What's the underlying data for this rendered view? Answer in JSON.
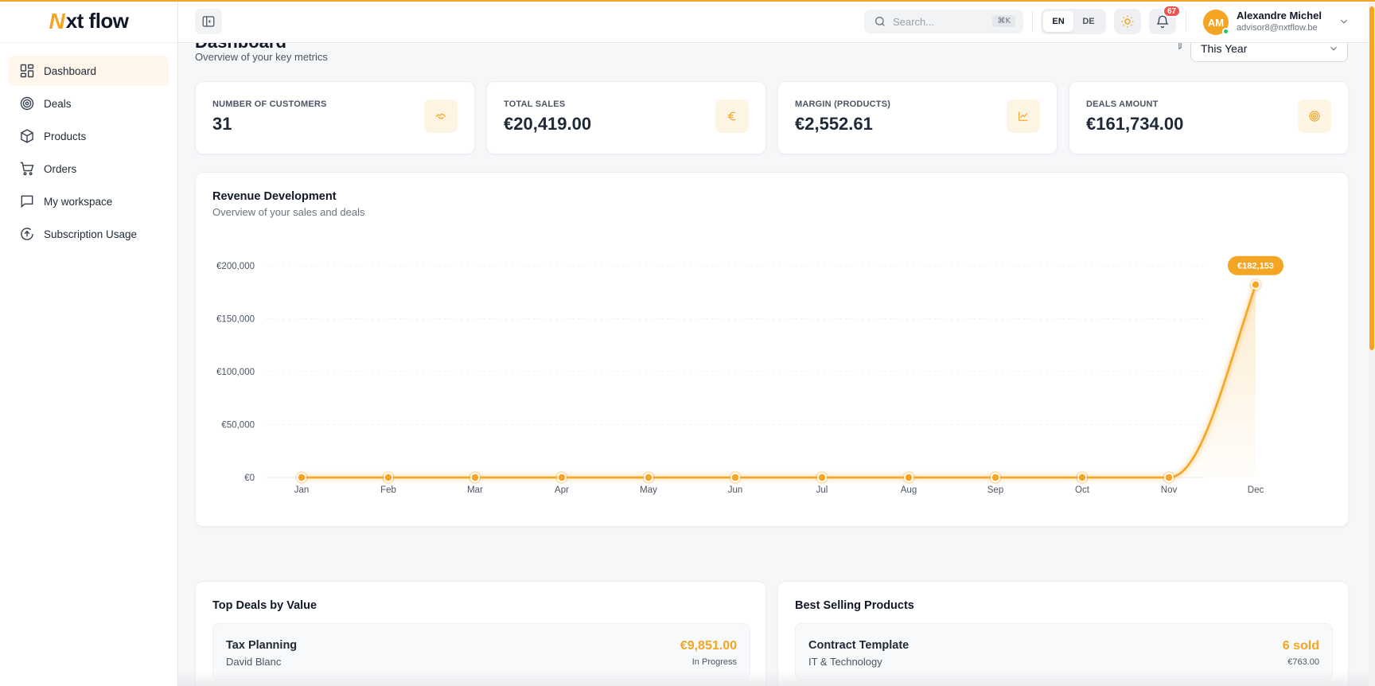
{
  "brand": {
    "logo_mark": "N",
    "logo_text": "xt flow"
  },
  "sidebar": {
    "items": [
      {
        "label": "Dashboard",
        "icon": "dashboard-grid-icon",
        "active": true
      },
      {
        "label": "Deals",
        "icon": "target-icon"
      },
      {
        "label": "Products",
        "icon": "box-icon"
      },
      {
        "label": "Orders",
        "icon": "cart-icon"
      },
      {
        "label": "My workspace",
        "icon": "chat-icon"
      },
      {
        "label": "Subscription Usage",
        "icon": "upload-circle-icon"
      }
    ]
  },
  "topbar": {
    "search_placeholder": "Search...",
    "search_shortcut": "⌘K",
    "languages": [
      "EN",
      "DE"
    ],
    "active_language": "EN",
    "notifications_count": "67",
    "user": {
      "initials": "AM",
      "name": "Alexandre Michel",
      "email": "advisor8@nxtflow.be"
    }
  },
  "page": {
    "title": "Dashboard",
    "subtitle": "Overview of your key metrics",
    "period": "This Year"
  },
  "kpis": [
    {
      "label": "NUMBER OF CUSTOMERS",
      "value": "31",
      "icon": "handshake-icon"
    },
    {
      "label": "TOTAL SALES",
      "value": "€20,419.00",
      "icon": "euro-icon"
    },
    {
      "label": "MARGIN (PRODUCTS)",
      "value": "€2,552.61",
      "icon": "line-chart-icon"
    },
    {
      "label": "DEALS AMOUNT",
      "value": "€161,734.00",
      "icon": "target-icon"
    }
  ],
  "revenue": {
    "title": "Revenue Development",
    "subtitle": "Overview of your sales and deals"
  },
  "chart_data": {
    "type": "line",
    "categories": [
      "Jan",
      "Feb",
      "Mar",
      "Apr",
      "May",
      "Jun",
      "Jul",
      "Aug",
      "Sep",
      "Oct",
      "Nov",
      "Dec"
    ],
    "values": [
      0,
      0,
      0,
      0,
      0,
      0,
      0,
      0,
      0,
      0,
      0,
      182153
    ],
    "ylim": [
      0,
      200000
    ],
    "yticks": [
      0,
      50000,
      100000,
      150000,
      200000
    ],
    "ytick_labels": [
      "€0",
      "€50,000",
      "€100,000",
      "€150,000",
      "€200,000"
    ],
    "highlight_label": "€182,153",
    "grid": true,
    "color": "#f5a524"
  },
  "top_deals": {
    "title": "Top Deals by Value",
    "items": [
      {
        "name": "Tax Planning",
        "client": "David Blanc",
        "amount": "€9,851.00",
        "status": "In Progress"
      }
    ]
  },
  "best_products": {
    "title": "Best Selling Products",
    "items": [
      {
        "name": "Contract Template",
        "category": "IT & Technology",
        "sold": "6 sold",
        "revenue": "€763.00"
      }
    ]
  }
}
